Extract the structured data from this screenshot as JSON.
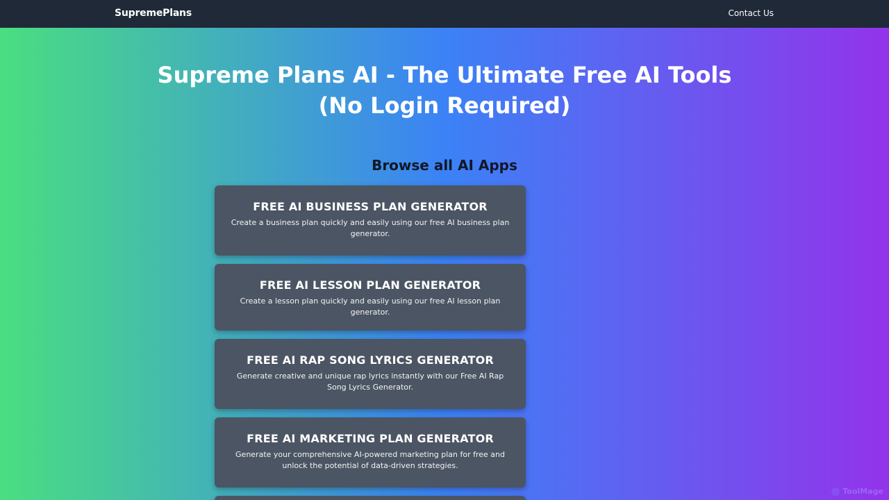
{
  "navbar": {
    "brand": "SupremePlans",
    "contact_link": "Contact Us"
  },
  "hero": {
    "title_line1": "Supreme Plans AI - The Ultimate Free AI Tools",
    "title_line2": "(No Login Required)"
  },
  "apps_section": {
    "heading": "Browse all AI Apps",
    "cards": [
      {
        "title": "FREE AI BUSINESS PLAN GENERATOR",
        "description": "Create a business plan quickly and easily using our free AI business plan generator."
      },
      {
        "title": "FREE AI LESSON PLAN GENERATOR",
        "description": "Create a lesson plan quickly and easily using our free AI lesson plan generator."
      },
      {
        "title": "FREE AI RAP SONG LYRICS GENERATOR",
        "description": "Generate creative and unique rap lyrics instantly with our Free AI Rap Song Lyrics Generator."
      },
      {
        "title": "FREE AI MARKETING PLAN GENERATOR",
        "description": "Generate your comprehensive AI-powered marketing plan for free and unlock the potential of data-driven strategies."
      }
    ]
  },
  "watermark": {
    "text": "ToolMage"
  },
  "colors": {
    "navbar_bg": "#1f2937",
    "gradient_start": "#4ade80",
    "gradient_mid": "#3b82f6",
    "gradient_end": "#9333ea",
    "card_bg": "#4b5563"
  }
}
